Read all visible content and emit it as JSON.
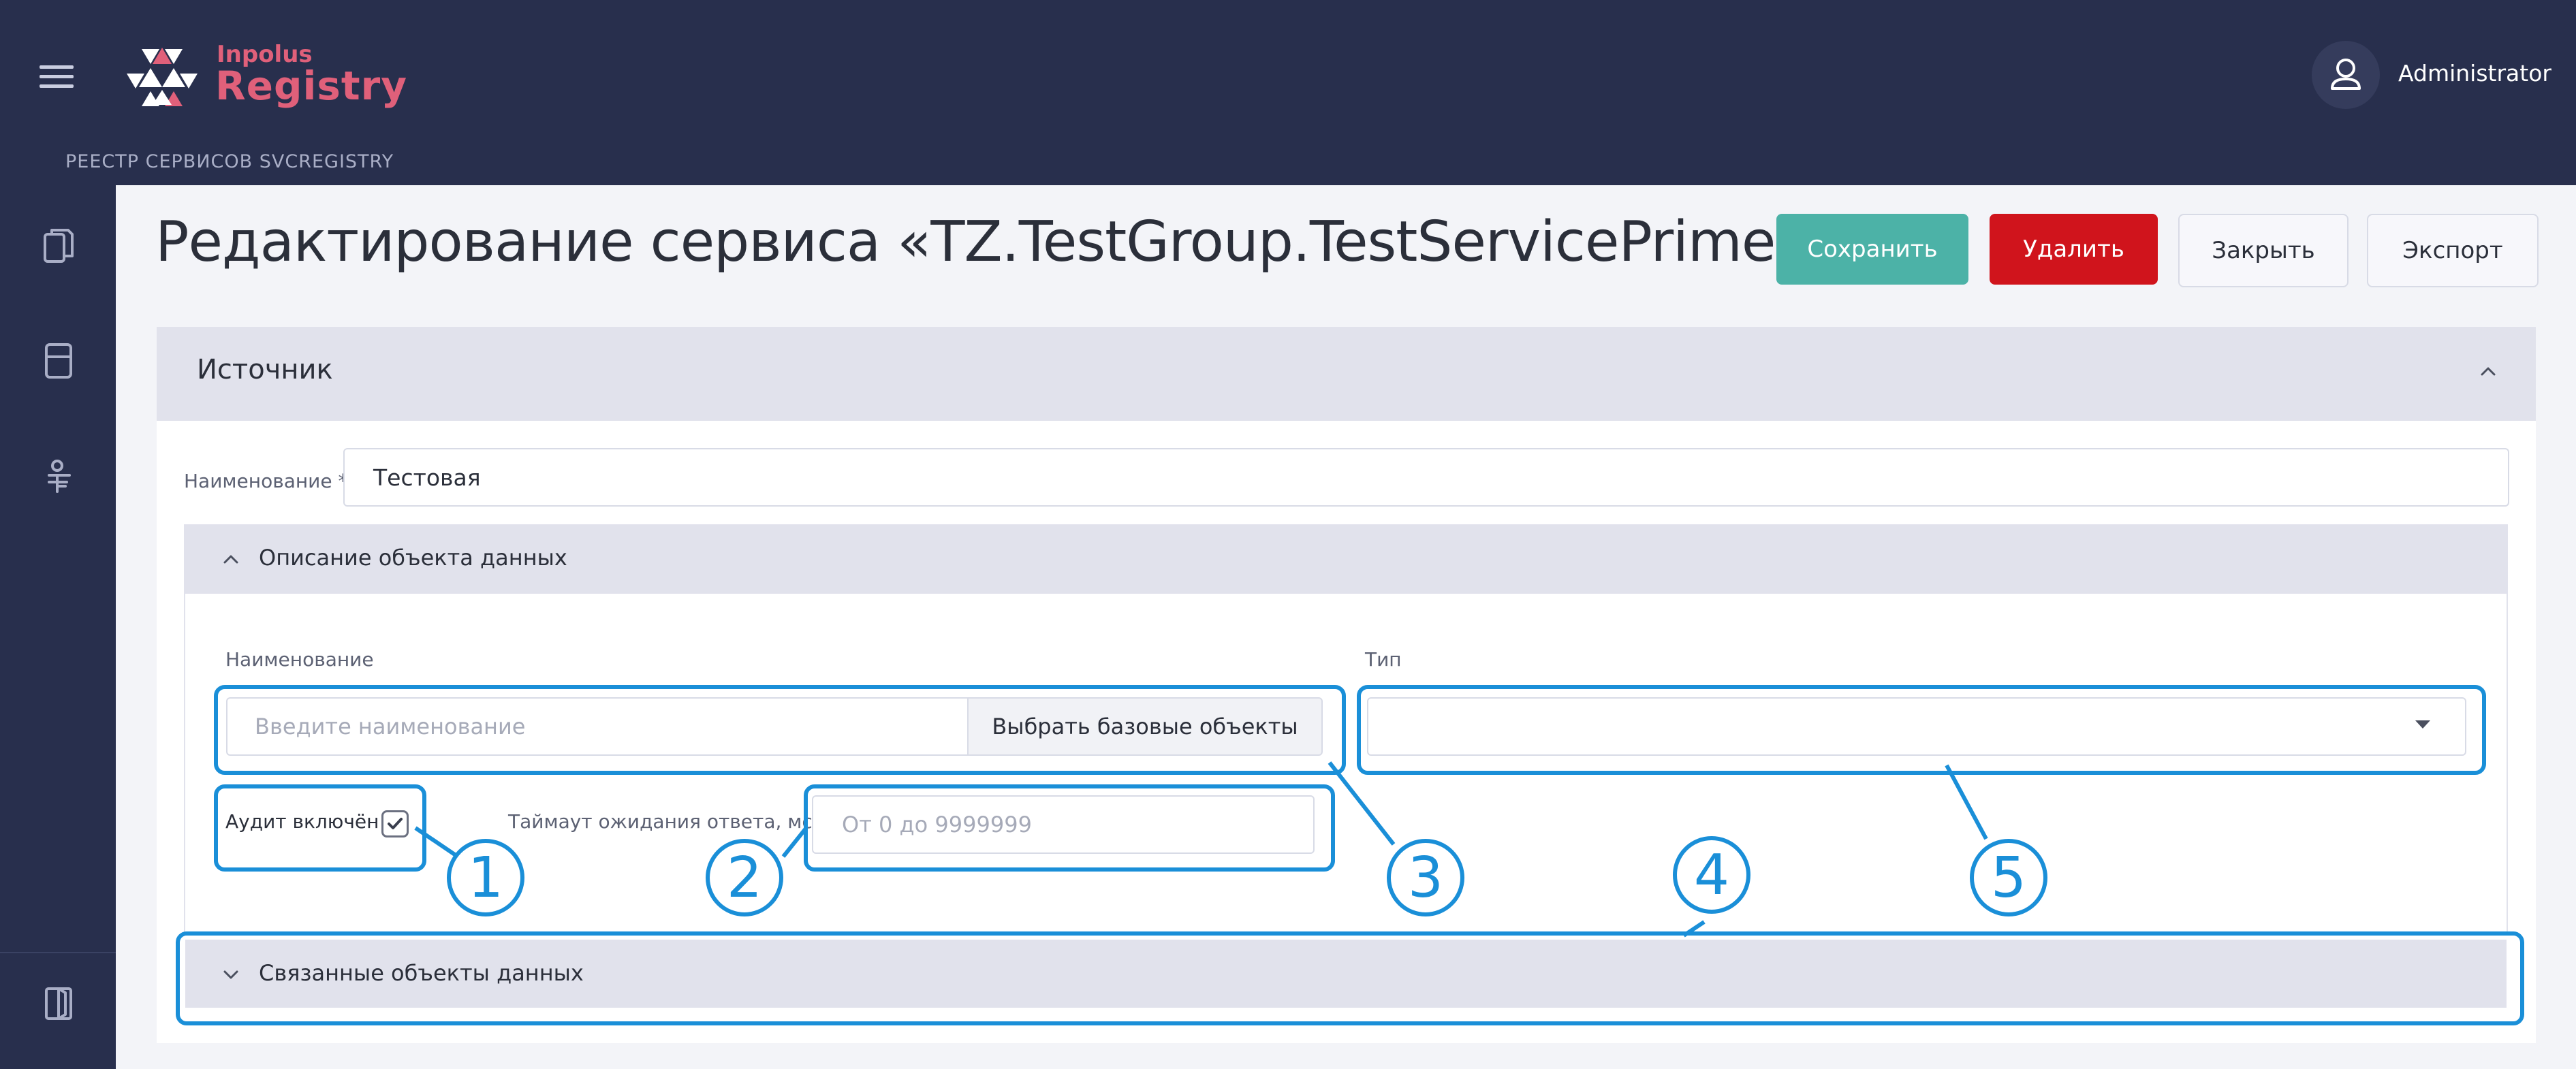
{
  "header": {
    "logo_small": "Inpolus",
    "logo_main": "Registry",
    "breadcrumb": "РЕЕСТР СЕРВИСОВ SVCREGISTRY",
    "user_name": "Administrator"
  },
  "sidebar": {
    "icons": [
      "documents-icon",
      "storage-icon",
      "registry-icon",
      "exit-icon"
    ]
  },
  "page": {
    "title": "Редактирование сервиса «TZ.TestGroup.TestServicePrime»"
  },
  "toolbar": {
    "save_label": "Сохранить",
    "delete_label": "Удалить",
    "close_label": "Закрыть",
    "export_label": "Экспорт"
  },
  "source_section": {
    "title": "Источник",
    "name_label": "Наименование *",
    "name_value": "Тестовая"
  },
  "data_object": {
    "title": "Описание объекта данных",
    "name_label": "Наименование",
    "name_placeholder": "Введите наименование",
    "pick_base_label": "Выбрать базовые объекты",
    "type_label": "Тип",
    "type_value": "",
    "audit_label": "Аудит включён",
    "audit_checked": true,
    "timeout_label": "Таймаут ожидания ответа, мсек.",
    "timeout_placeholder": "От 0 до 9999999"
  },
  "linked_objects": {
    "title": "Связанные объекты данных"
  },
  "callouts": [
    "1",
    "2",
    "3",
    "4",
    "5"
  ],
  "colors": {
    "header_bg": "#282f4d",
    "accent": "#e0607a",
    "save": "#4cb2a7",
    "delete": "#d0141c",
    "callout": "#1a8fd8"
  }
}
